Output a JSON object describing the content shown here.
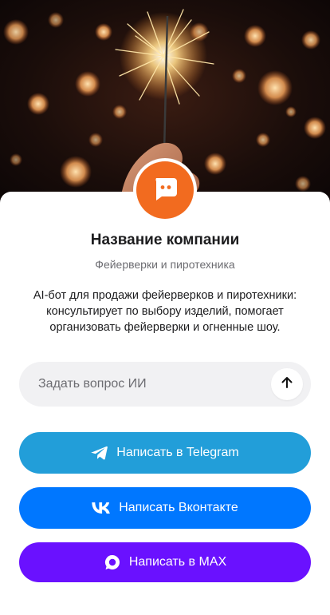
{
  "hero": {
    "image": "sparkler-fireworks-photo"
  },
  "company": {
    "avatar_icon": "chat-bubble-icon",
    "name": "Название компании",
    "category": "Фейерверки и пиротехника",
    "description": "AI-бот для продажи фейерверков и пиротехники: консультирует по выбору изделий, помогает организовать фейерверки и огненные шоу."
  },
  "ask": {
    "placeholder": "Задать вопрос ИИ",
    "value": "",
    "send_icon": "arrow-up-icon"
  },
  "buttons": {
    "telegram": {
      "label": "Написать в Telegram",
      "icon": "telegram-icon",
      "color": "#229ED9"
    },
    "vk": {
      "label": "Написать Вконтакте",
      "icon": "vk-icon",
      "color": "#0077FF"
    },
    "max": {
      "label": "Написать в MAX",
      "icon": "max-icon",
      "color": "#6A11FF"
    }
  },
  "colors": {
    "avatar": "#F26B1F",
    "card": "#FFFFFF",
    "input_bg": "#F1F1F3"
  }
}
